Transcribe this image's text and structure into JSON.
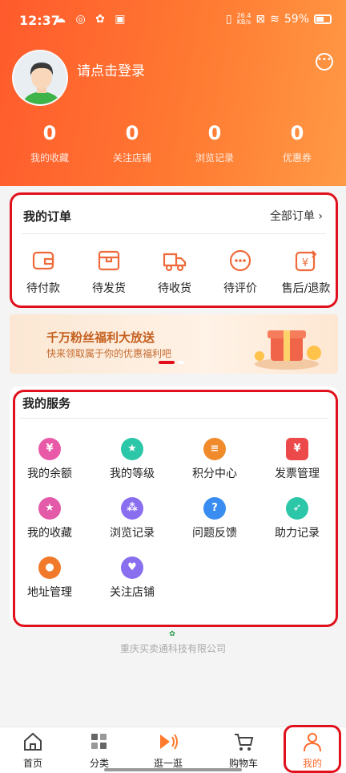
{
  "status_bar": {
    "time": "12:37",
    "network_speed": "26.4\nKB/s",
    "battery": "59%"
  },
  "profile": {
    "login_prompt": "请点击登录"
  },
  "stats": [
    {
      "value": "0",
      "label": "我的收藏"
    },
    {
      "value": "0",
      "label": "关注店铺"
    },
    {
      "value": "0",
      "label": "浏览记录"
    },
    {
      "value": "0",
      "label": "优惠券"
    }
  ],
  "orders": {
    "title": "我的订单",
    "all_label": "全部订单",
    "items": [
      {
        "label": "待付款",
        "icon": "wallet-icon"
      },
      {
        "label": "待发货",
        "icon": "box-icon"
      },
      {
        "label": "待收货",
        "icon": "truck-icon"
      },
      {
        "label": "待评价",
        "icon": "comment-icon"
      },
      {
        "label": "售后/退款",
        "icon": "refund-icon"
      }
    ]
  },
  "banner": {
    "title": "千万粉丝福利大放送",
    "subtitle": "快来领取属于你的优惠福利吧"
  },
  "services": {
    "title": "我的服务",
    "items": [
      {
        "label": "我的余额",
        "icon": "balance-icon",
        "color": "#e85aa8"
      },
      {
        "label": "我的等级",
        "icon": "level-icon",
        "color": "#2cc6a8"
      },
      {
        "label": "积分中心",
        "icon": "points-icon",
        "color": "#f08a2a"
      },
      {
        "label": "发票管理",
        "icon": "invoice-icon",
        "color": "#ec4a4a"
      },
      {
        "label": "我的收藏",
        "icon": "star-icon",
        "color": "#e35aa8"
      },
      {
        "label": "浏览记录",
        "icon": "footprint-icon",
        "color": "#8a6ef0"
      },
      {
        "label": "问题反馈",
        "icon": "question-icon",
        "color": "#3a8df0"
      },
      {
        "label": "助力记录",
        "icon": "rocket-icon",
        "color": "#2cc6a8"
      },
      {
        "label": "地址管理",
        "icon": "location-icon",
        "color": "#f07a2a"
      },
      {
        "label": "关注店铺",
        "icon": "heart-icon",
        "color": "#8a6ef0"
      }
    ]
  },
  "company": {
    "name": "重庆买卖通科技有限公司"
  },
  "tabbar": {
    "items": [
      {
        "label": "首页",
        "icon": "home-icon"
      },
      {
        "label": "分类",
        "icon": "category-icon"
      },
      {
        "label": "逛一逛",
        "icon": "play-icon"
      },
      {
        "label": "购物车",
        "icon": "cart-icon"
      },
      {
        "label": "我的",
        "icon": "user-icon"
      }
    ],
    "active": "我的"
  },
  "colors": {
    "accent": "#ff6d2e",
    "highlight_border": "#e0111c"
  }
}
